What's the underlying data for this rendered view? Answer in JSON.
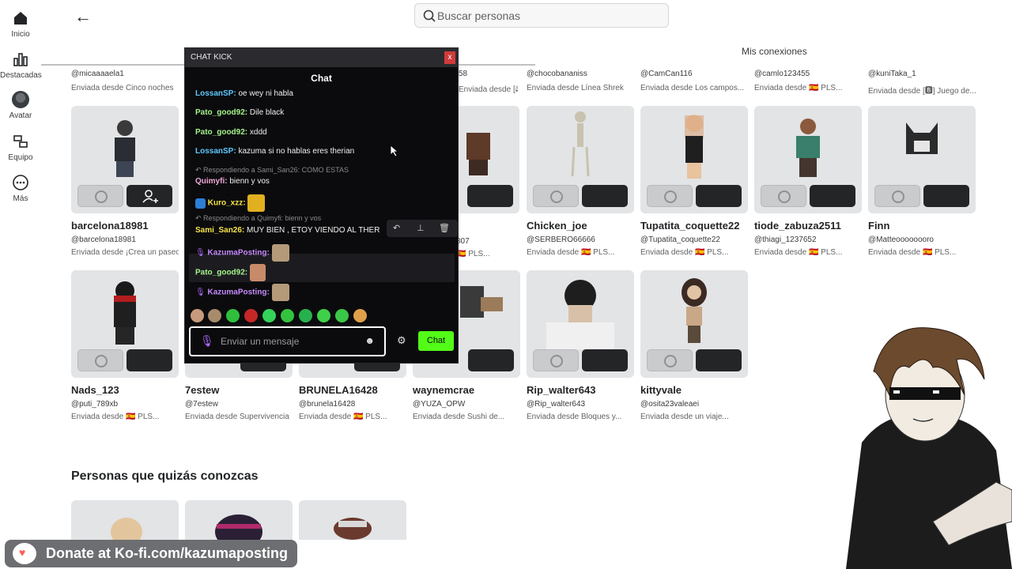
{
  "nav": {
    "items": [
      {
        "label": "Inicio",
        "icon": "home-icon"
      },
      {
        "label": "Destacadas",
        "icon": "charts-icon"
      },
      {
        "label": "Avatar",
        "icon": "avatar-icon"
      },
      {
        "label": "Equipo",
        "icon": "group-icon"
      },
      {
        "label": "Más",
        "icon": "more-icon"
      }
    ]
  },
  "search": {
    "placeholder": "Buscar personas"
  },
  "tabs": {
    "connections": "Mis conexiones"
  },
  "top_row": [
    {
      "handle": "@micaaaaela1",
      "sent": "Enviada desde Cinco noches"
    },
    {
      "handle": "@chocobananiss",
      "sent": "Enviada desde Línea Shrek"
    },
    {
      "handle": "@CamCan116",
      "sent": "Enviada desde Los campos..."
    },
    {
      "handle": "@camlo123455",
      "sent": "Enviada desde 🇪🇸 PLS..."
    },
    {
      "handle": "@kuniTaka_1",
      "sent": "Enviada desde [🅱] Juego de..."
    }
  ],
  "top_partial": {
    "handle": "58",
    "sent": "Enviada desde [🕮]"
  },
  "cards_row1": [
    {
      "name": "barcelona18981",
      "handle": "@barcelona18981",
      "sent": "Enviada desde ¡Crea un paseo"
    },
    {
      "name": "Chicken_joe",
      "handle": "@SERBERO66666",
      "sent": "Enviada desde 🇪🇸 PLS..."
    },
    {
      "name": "Tupatita_coquette22",
      "handle": "@Tupatita_coquette22",
      "sent": "Enviada desde 🇪🇸 PLS..."
    },
    {
      "name": "tiode_zabuza2511",
      "handle": "@thiagi_1237652",
      "sent": "Enviada desde 🇪🇸 PLS..."
    },
    {
      "name": "Finn",
      "handle": "@Matteoooooooro",
      "sent": "Enviada desde 🇪🇸 PLS..."
    }
  ],
  "row1_partial": {
    "handle": "807",
    "sent": "🇪🇸 PLS..."
  },
  "cards_row2": [
    {
      "name": "Nads_123",
      "handle": "@puti_789xb",
      "sent": "Enviada desde 🇪🇸 PLS..."
    },
    {
      "name": "7estew",
      "handle": "@7estew",
      "sent": "Enviada desde Supervivencia"
    },
    {
      "name": "BRUNELA16428",
      "handle": "@brunela16428",
      "sent": "Enviada desde 🇪🇸 PLS..."
    },
    {
      "name": "waynemcrae",
      "handle": "@YUZA_OPW",
      "sent": "Enviada desde Sushi de..."
    },
    {
      "name": "Rip_walter643",
      "handle": "@Rip_walter643",
      "sent": "Enviada desde Bloques y..."
    },
    {
      "name": "kittyvale",
      "handle": "@osita23valeaei",
      "sent": "Enviada desde un viaje..."
    }
  ],
  "suggestions": {
    "title": "Personas que quizás conozcas"
  },
  "chat": {
    "window_title": "CHAT KICK",
    "close": "x",
    "heading": "Chat",
    "messages": [
      {
        "user": "LossanSP:",
        "text": "oe wey ni habla"
      },
      {
        "user": "Pato_good92:",
        "text": "Dile black"
      },
      {
        "user": "Pato_good92:",
        "text": "xddd"
      },
      {
        "user": "LossanSP:",
        "text": "kazuma si no hablas eres therian"
      },
      {
        "reply": "↶ Respondiendo a Sami_San26: COMO ESTAS"
      },
      {
        "user": "Quimyfi:",
        "text": "bienn y vos"
      },
      {
        "user": "Kuro_xzz:",
        "text": ""
      },
      {
        "reply": "↶ Respondiendo a Quimyfi: bienn y vos"
      },
      {
        "user": "Sami_San26:",
        "text": "MUY BIEN , ETOY VIENDO AL THER"
      },
      {
        "user": "KazumaPosting:",
        "text": ""
      },
      {
        "user": "Pato_good92:",
        "text": ""
      },
      {
        "user": "KazumaPosting:",
        "text": ""
      }
    ],
    "input_placeholder": "Enviar un mensaje",
    "send_label": "Chat",
    "colors": {
      "accent": "#53fc18",
      "bg": "#0b0b0d"
    }
  },
  "donate": {
    "text": "Donate at Ko-fi.com/kazumaposting"
  }
}
